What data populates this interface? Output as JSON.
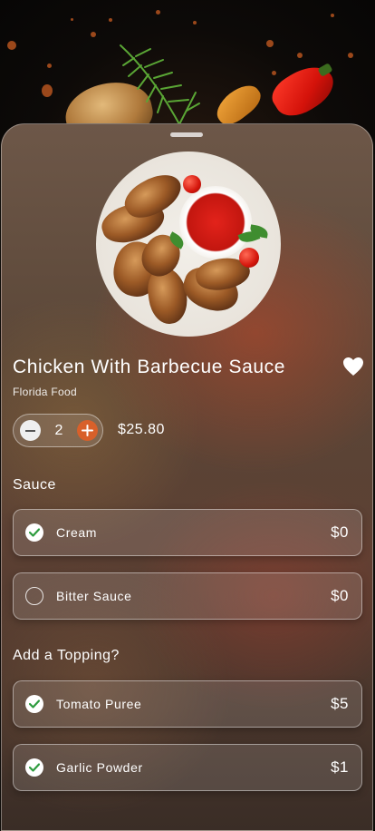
{
  "product": {
    "title": "Chicken With Barbecue Sauce",
    "subtitle": "Florida Food",
    "quantity": "2",
    "price": "$25.80",
    "favorite": true
  },
  "sections": {
    "sauce_title": "Sauce",
    "topping_title": "Add a Topping?"
  },
  "sauce_options": [
    {
      "label": "Cream",
      "price": "$0",
      "selected": true
    },
    {
      "label": "Bitter Sauce",
      "price": "$0",
      "selected": false
    }
  ],
  "topping_options": [
    {
      "label": "Tomato Puree",
      "price": "$5",
      "selected": true
    },
    {
      "label": "Garlic Powder",
      "price": "$1",
      "selected": true
    }
  ],
  "icons": {
    "favorite": "heart-icon",
    "decrement": "minus-icon",
    "increment": "plus-icon",
    "selected": "check-icon"
  },
  "colors": {
    "accent": "#d8602a",
    "check": "#2e9c3f"
  }
}
